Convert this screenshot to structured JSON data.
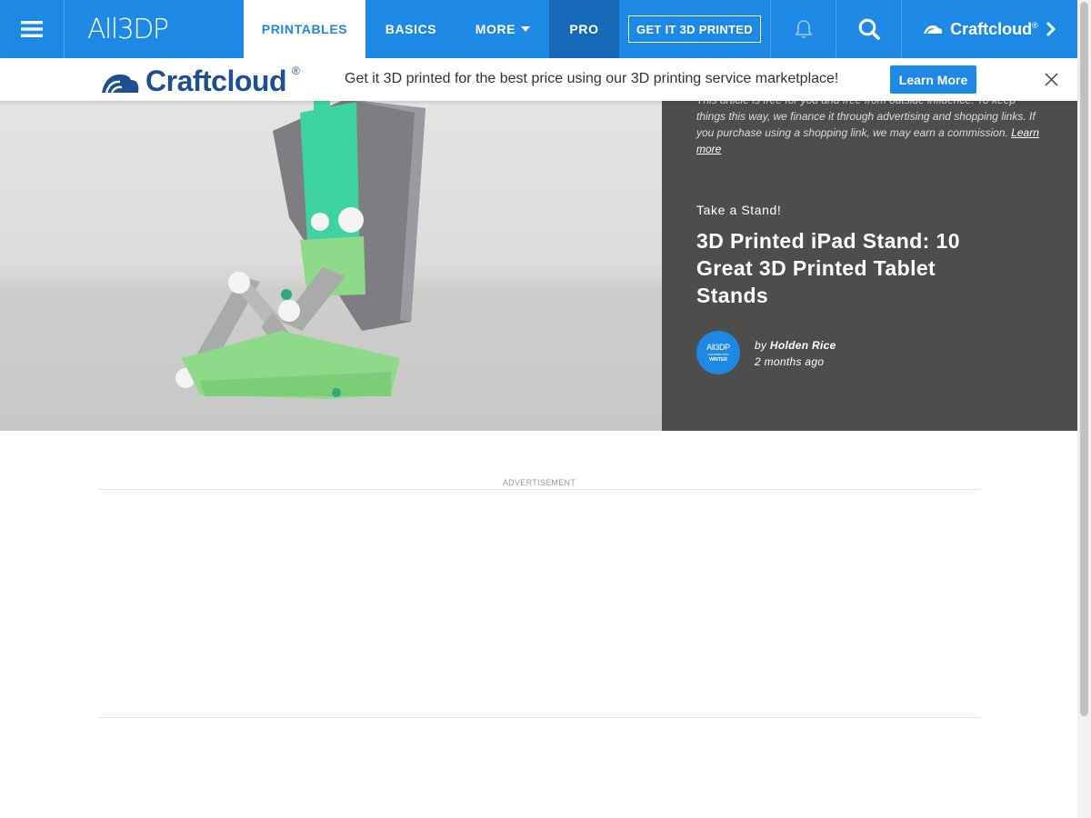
{
  "nav": {
    "logo": "All3DP",
    "tabs": [
      {
        "label": "PRINTABLES",
        "active": true
      },
      {
        "label": "BASICS"
      },
      {
        "label": "MORE"
      },
      {
        "label": "PRO"
      }
    ],
    "get_printed_label": "GET IT 3D PRINTED",
    "craftcloud_label": "Craftcloud",
    "registered_mark": "®",
    "icons": [
      "hamburger-menu-icon",
      "caret-down-icon",
      "bell-icon",
      "search-icon",
      "chevron-right-icon",
      "craftcloud-cloud-icon"
    ]
  },
  "promo": {
    "logo_text": "Craftcloud",
    "registered_mark": "®",
    "text": "Get it 3D printed for the best price using our 3D printing service marketplace!",
    "button_label": "Learn More",
    "close_icon": "close-icon"
  },
  "article": {
    "disclaimer_line1": "This article is free for you and free from outside influence. To keep things this way, we finance it through advertising and shopping links. If you purchase using a shopping link, we may earn a commission.",
    "disclaimer_link": "Learn more",
    "kicker": "Take a Stand!",
    "headline": "3D Printed iPad Stand: 10 Great 3D Printed Tablet Stands",
    "avatar": {
      "logo": "All3DP",
      "sub": "CONTRIBUTING",
      "role": "WRITER"
    },
    "byline_prefix": "by",
    "author": "Holden Rice",
    "time_ago": "2 months ago"
  },
  "ad": {
    "label": "ADVERTISEMENT"
  },
  "colors": {
    "brand_blue": "#1e88e5",
    "pro_blue": "#1668b8",
    "panel_gray": "#4d4d4d",
    "craftcloud_navy": "#1d4f91",
    "stand_green": "#8fd98a",
    "mount_teal": "#3fd3a3"
  }
}
